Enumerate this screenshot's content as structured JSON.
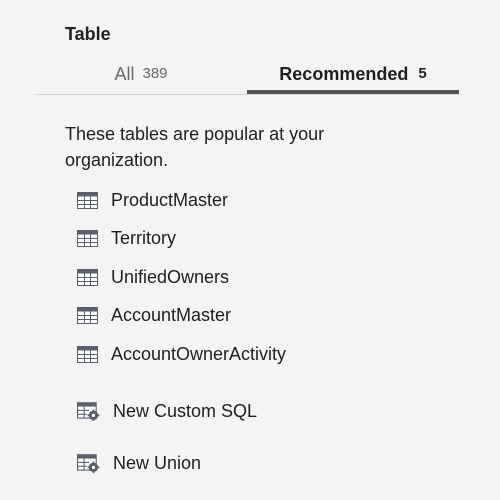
{
  "section": {
    "title": "Table"
  },
  "tabs": [
    {
      "label": "All",
      "count": "389",
      "active": false
    },
    {
      "label": "Recommended",
      "count": "5",
      "active": true
    }
  ],
  "description": "These tables are popular at your organization.",
  "tables": [
    {
      "name": "ProductMaster",
      "icon": "table-grid-icon"
    },
    {
      "name": "Territory",
      "icon": "table-grid-icon"
    },
    {
      "name": "UnifiedOwners",
      "icon": "table-grid-icon"
    },
    {
      "name": "AccountMaster",
      "icon": "table-grid-icon"
    },
    {
      "name": "AccountOwnerActivity",
      "icon": "table-grid-icon"
    }
  ],
  "actions": [
    {
      "name": "New Custom SQL",
      "icon": "table-gear-icon"
    },
    {
      "name": "New Union",
      "icon": "table-gear-icon"
    }
  ],
  "colors": {
    "background": "#f4f4f4",
    "active_tab_underline": "#555555",
    "icon": "#5a5f6b"
  }
}
